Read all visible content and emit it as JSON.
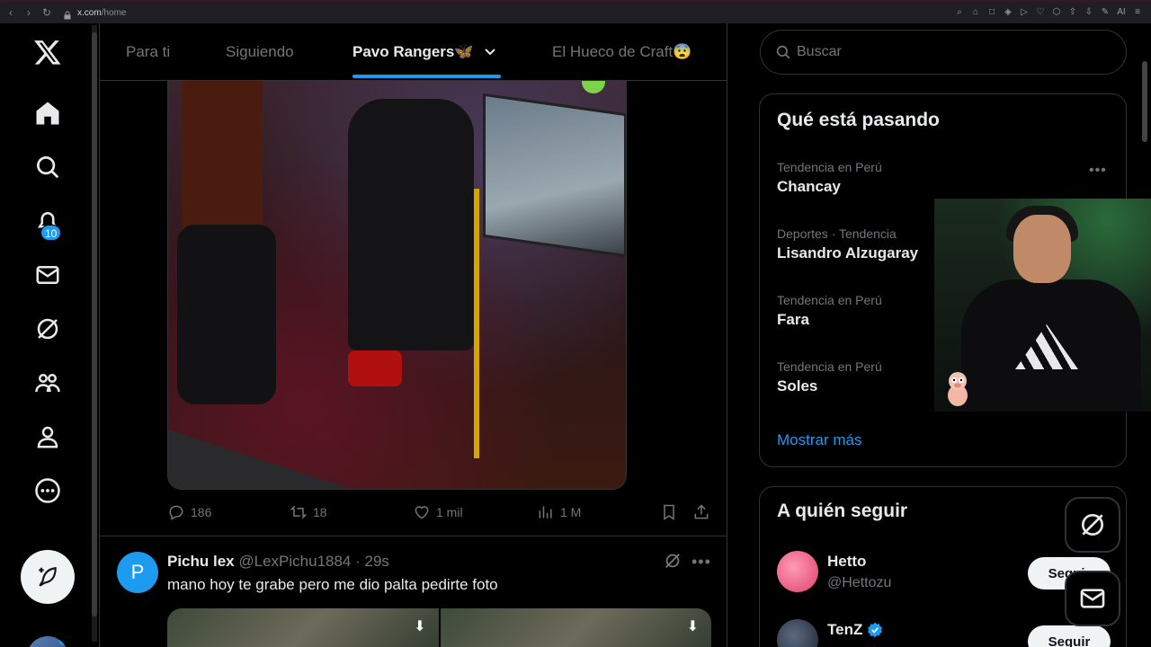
{
  "browser": {
    "url_host": "x.com",
    "url_path": "/home",
    "ext_ai_label": "AI"
  },
  "nav": {
    "notifications_badge": "10"
  },
  "tabs": [
    {
      "label": "Para ti"
    },
    {
      "label": "Siguiendo"
    },
    {
      "label": "Pavo Rangers🦋"
    },
    {
      "label": "El Hueco de Craft😨"
    }
  ],
  "tweet1": {
    "replies": "186",
    "reposts": "18",
    "likes": "1 mil",
    "views": "1 M"
  },
  "tweet2": {
    "avatar_letter": "P",
    "name": "Pichu lex",
    "handle": "@LexPichu1884",
    "time": "· 29s",
    "text": "mano hoy te grabe pero me dio palta pedirte foto"
  },
  "search": {
    "placeholder": "Buscar"
  },
  "trends": {
    "title": "Qué está pasando",
    "items": [
      {
        "meta": "Tendencia en Perú",
        "title": "Chancay"
      },
      {
        "meta": "Deportes · Tendencia",
        "title": "Lisandro Alzugaray"
      },
      {
        "meta": "Tendencia en Perú",
        "title": "Fara"
      },
      {
        "meta": "Tendencia en Perú",
        "title": "Soles"
      }
    ],
    "show_more": "Mostrar más"
  },
  "who_to_follow": {
    "title": "A quién seguir",
    "items": [
      {
        "name": "Hetto",
        "handle": "@Hettozu",
        "button": "Seguir"
      },
      {
        "name": "TenZ",
        "handle": "",
        "button": "Seguir"
      }
    ]
  },
  "colors": {
    "accent": "#1d9bf0",
    "background": "#000000",
    "border": "#2f3336",
    "muted_text": "#71767b"
  }
}
